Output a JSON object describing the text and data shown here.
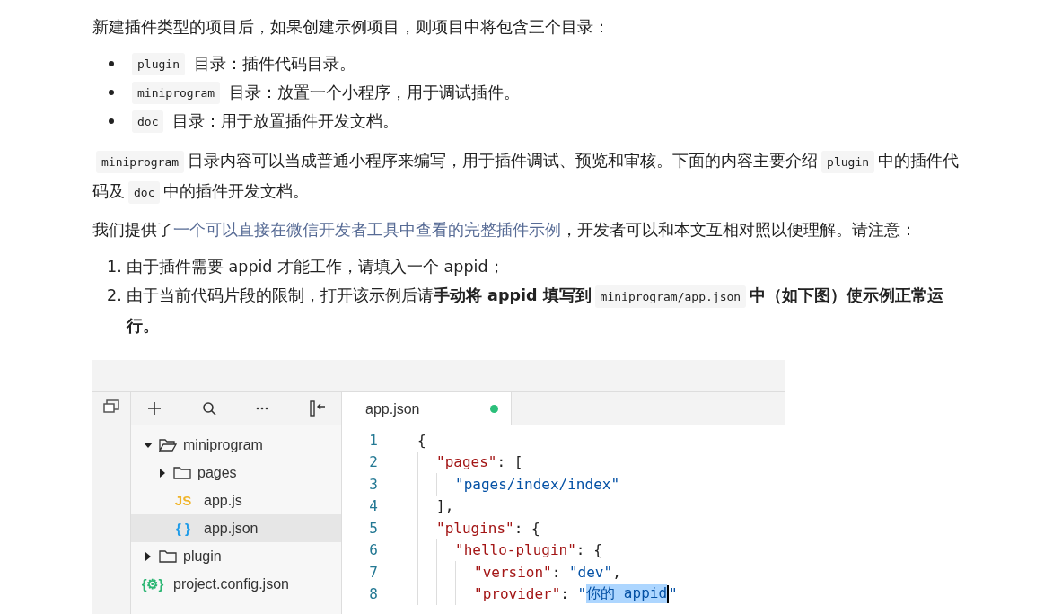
{
  "intro": "新建插件类型的项目后，如果创建示例项目，则项目中将包含三个目录：",
  "dirs": [
    {
      "code": "plugin",
      "text": "目录：插件代码目录。"
    },
    {
      "code": "miniprogram",
      "text": "目录：放置一个小程序，用于调试插件。"
    },
    {
      "code": "doc",
      "text": "目录：用于放置插件开发文档。"
    }
  ],
  "para": [
    {
      "kind": "code",
      "text": "miniprogram"
    },
    {
      "kind": "text",
      "text": "目录内容可以当成普通小程序来编写，用于插件调试、预览和审核。下面的内容主要介绍"
    },
    {
      "kind": "code",
      "text": "plugin"
    },
    {
      "kind": "text",
      "text": "中的插件代码及"
    },
    {
      "kind": "code",
      "text": "doc"
    },
    {
      "kind": "text",
      "text": "中的插件开发文档。"
    }
  ],
  "provide": {
    "before": "我们提供了",
    "link": "一个可以直接在微信开发者工具中查看的完整插件示例",
    "after": "，开发者可以和本文互相对照以便理解。请注意："
  },
  "notes": [
    {
      "num": "1.",
      "parts": [
        {
          "kind": "text",
          "text": "由于插件需要 appid 才能工作，请填入一个 appid；"
        }
      ]
    },
    {
      "num": "2.",
      "parts": [
        {
          "kind": "text",
          "text": "由于当前代码片段的限制，打开该示例后请"
        },
        {
          "kind": "bold",
          "text": "手动将 appid 填写到"
        },
        {
          "kind": "code",
          "text": "miniprogram/app.json"
        },
        {
          "kind": "bold",
          "text": "中（如下图）使示例正常运行。"
        }
      ]
    }
  ],
  "ide": {
    "tree": [
      {
        "kind": "folder",
        "name": "miniprogram",
        "expanded": true,
        "selected": false,
        "children": [
          {
            "kind": "folder",
            "name": "pages",
            "expanded": false,
            "selected": false
          },
          {
            "kind": "file",
            "icon_text": "JS",
            "color": "#f0b429",
            "name": "app.js",
            "selected": false
          },
          {
            "kind": "file",
            "icon_text": "{ }",
            "color": "#1e9be8",
            "name": "app.json",
            "selected": true
          }
        ]
      },
      {
        "kind": "folder",
        "name": "plugin",
        "expanded": false,
        "selected": false
      },
      {
        "kind": "file",
        "icon_text": "{⚙}",
        "color": "#2bb673",
        "name": "project.config.json",
        "selected": false
      }
    ],
    "tab": {
      "label": "app.json",
      "modified": true
    },
    "code": [
      {
        "num": "1",
        "tokens": [
          {
            "kind": "punct",
            "text": "{"
          }
        ]
      },
      {
        "num": "2",
        "tokens": [
          {
            "kind": "key",
            "text": "  \"pages\""
          },
          {
            "kind": "punct",
            "text": ": ["
          }
        ]
      },
      {
        "num": "3",
        "tokens": [
          {
            "kind": "string",
            "text": "    \"pages/index/index\""
          }
        ]
      },
      {
        "num": "4",
        "tokens": [
          {
            "kind": "punct",
            "text": "  ],"
          }
        ]
      },
      {
        "num": "5",
        "tokens": [
          {
            "kind": "key",
            "text": "  \"plugins\""
          },
          {
            "kind": "punct",
            "text": ": {"
          }
        ]
      },
      {
        "num": "6",
        "tokens": [
          {
            "kind": "key",
            "text": "    \"hello-plugin\""
          },
          {
            "kind": "punct",
            "text": ": {"
          }
        ]
      },
      {
        "num": "7",
        "tokens": [
          {
            "kind": "key",
            "text": "      \"version\""
          },
          {
            "kind": "punct",
            "text": ": "
          },
          {
            "kind": "string",
            "text": "\"dev\""
          },
          {
            "kind": "punct",
            "text": ","
          }
        ]
      },
      {
        "num": "8",
        "tokens": [
          {
            "kind": "key",
            "text": "      \"provider\""
          },
          {
            "kind": "punct",
            "text": ": "
          },
          {
            "kind": "string",
            "text": "\""
          },
          {
            "kind": "selected",
            "text": "你的 appid"
          },
          {
            "kind": "cursor"
          },
          {
            "kind": "string",
            "text": "\""
          }
        ]
      }
    ]
  }
}
